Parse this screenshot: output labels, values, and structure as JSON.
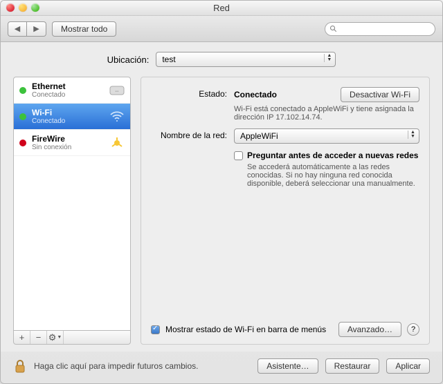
{
  "window": {
    "title": "Red"
  },
  "toolbar": {
    "back": "◀",
    "forward": "▶",
    "show_all": "Mostrar todo",
    "search_placeholder": ""
  },
  "location": {
    "label": "Ubicación:",
    "value": "test"
  },
  "sidebar": {
    "items": [
      {
        "name": "Ethernet",
        "status": "Conectado",
        "dot": "green",
        "icon": "ethernet"
      },
      {
        "name": "Wi-Fi",
        "status": "Conectado",
        "dot": "green",
        "icon": "wifi"
      },
      {
        "name": "FireWire",
        "status": "Sin conexión",
        "dot": "red",
        "icon": "firewire"
      }
    ],
    "footer": {
      "add": "+",
      "remove": "−",
      "gear": "⚙"
    }
  },
  "detail": {
    "state_label": "Estado:",
    "state_value": "Conectado",
    "toggle_wifi": "Desactivar Wi-Fi",
    "state_desc": "Wi-Fi está conectado a AppleWiFi y tiene asignada la dirección IP 17.102.14.74.",
    "network_label": "Nombre de la red:",
    "network_value": "AppleWiFi",
    "ask_label": "Preguntar antes de acceder a nuevas redes",
    "ask_desc": "Se accederá automáticamente a las redes conocidas. Si no hay ninguna red conocida disponible, deberá seleccionar una manualmente.",
    "show_menu_label": "Mostrar estado de Wi-Fi en barra de menús",
    "advanced": "Avanzado…",
    "help": "?"
  },
  "bottom": {
    "lock_text": "Haga clic aquí para impedir futuros cambios.",
    "assistant": "Asistente…",
    "revert": "Restaurar",
    "apply": "Aplicar"
  }
}
